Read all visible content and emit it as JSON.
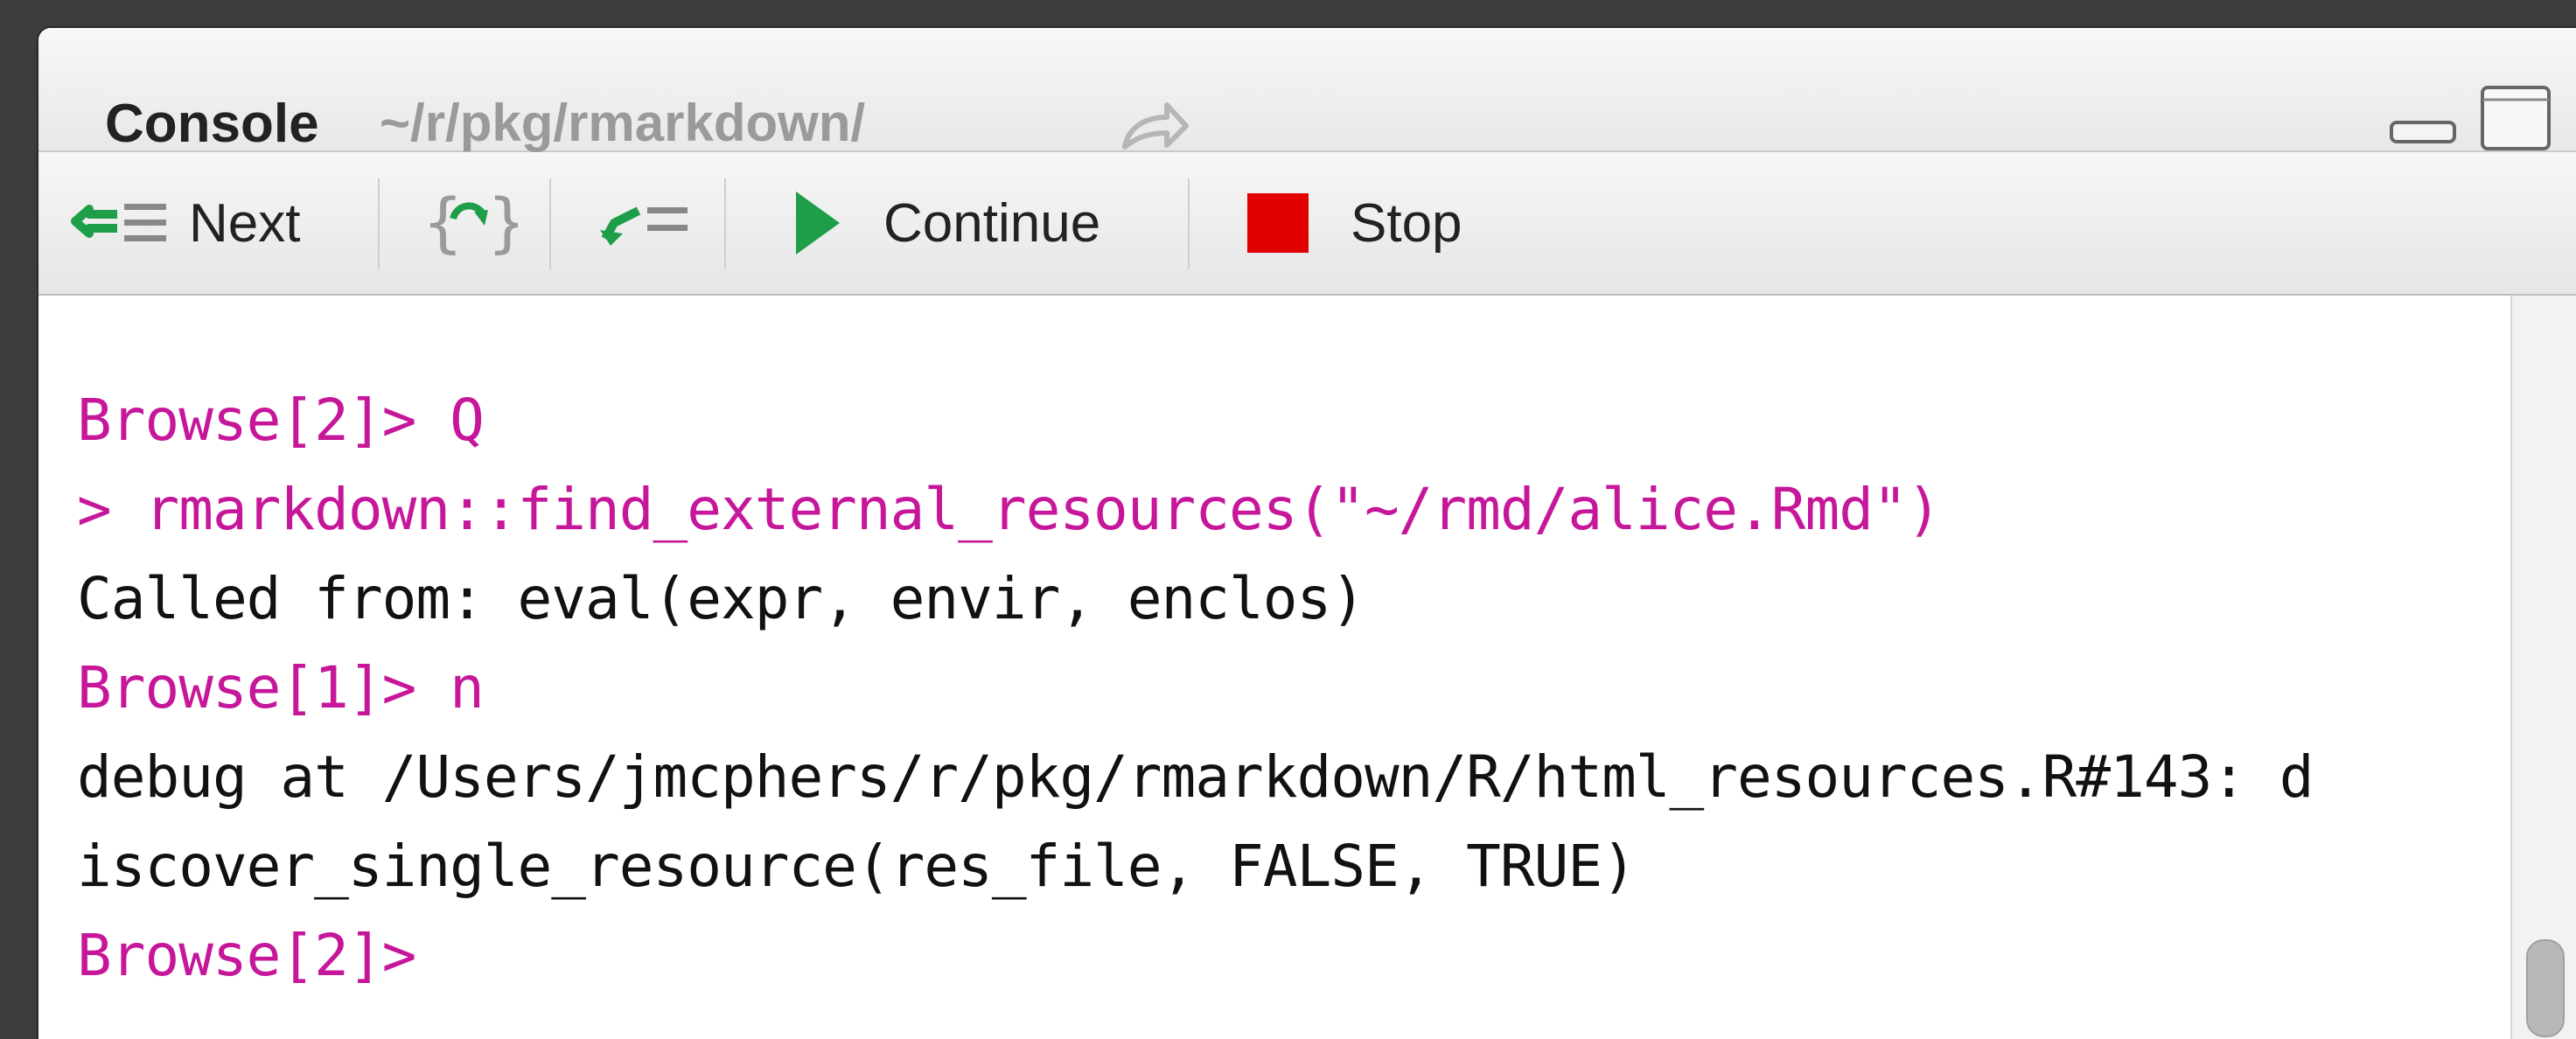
{
  "window": {
    "title": "Console",
    "path": "~/r/pkg/rmarkdown/"
  },
  "toolbar": {
    "next_label": "Next",
    "continue_label": "Continue",
    "stop_label": "Stop"
  },
  "console": {
    "lines": [
      "Browse[2]> Q",
      "> rmarkdown::find_external_resources(\"~/rmd/alice.Rmd\")",
      "Called from: eval(expr, envir, enclos)",
      "Browse[1]> n",
      "debug at /Users/jmcphers/r/pkg/rmarkdown/R/html_resources.R#143: d",
      "iscover_single_resource(res_file, FALSE, TRUE)",
      "Browse[2]>"
    ]
  },
  "icons": {
    "share": "share-arrow-icon",
    "next": "next-line-icon",
    "step_into": "step-into-icon",
    "finish": "finish-function-icon",
    "continue": "play-icon",
    "stop": "stop-square-icon",
    "minimize": "minimize-icon",
    "maximize": "maximize-icon"
  },
  "colors": {
    "prompt": "#c6169a",
    "output": "#111111",
    "accent_green": "#1f9e4a",
    "stop_red": "#e00000"
  }
}
